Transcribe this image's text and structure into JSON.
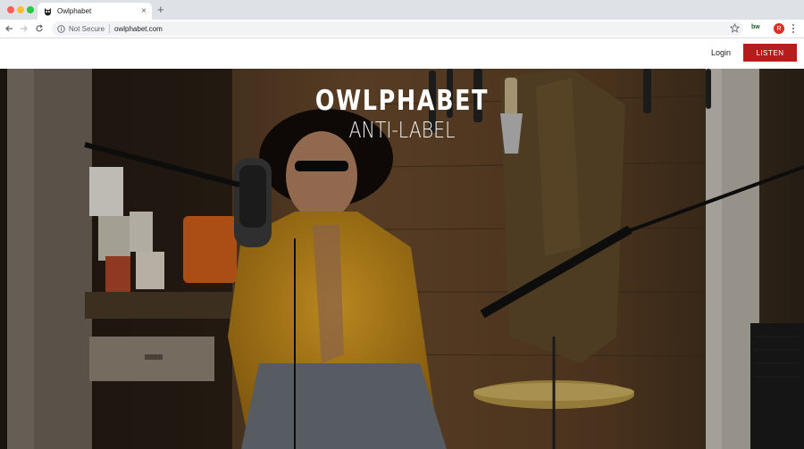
{
  "browser": {
    "tab_title": "Owlphabet",
    "tab_close": "×",
    "new_tab": "+",
    "security_label": "Not Secure",
    "url": "owlphabet.com",
    "extension_badge": "bw",
    "profile_initial": "R"
  },
  "header": {
    "login_label": "Login",
    "listen_label": "LISTEN",
    "listen_color": "#b71c1c"
  },
  "hero": {
    "title": "OWLPHABET",
    "subtitle": "ANTI-LABEL",
    "image_description_icon": "video-still"
  }
}
